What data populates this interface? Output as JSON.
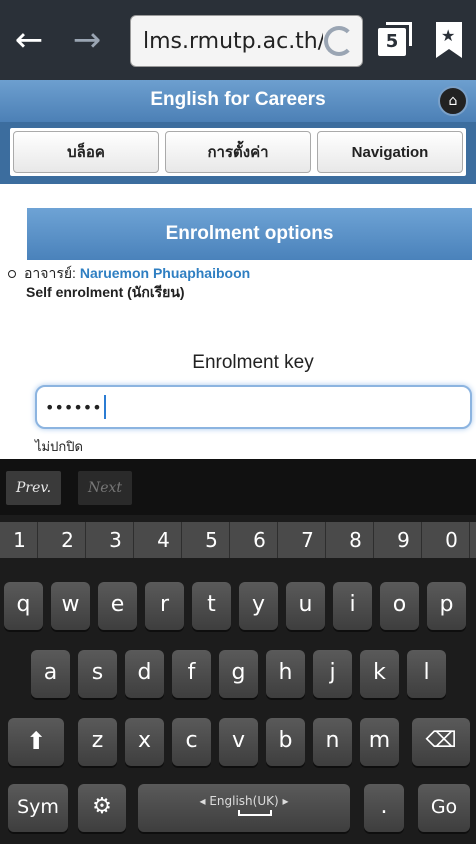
{
  "browser": {
    "url": "lms.rmutp.ac.th/l",
    "tab_count": "5",
    "back_icon": "arrow-left-icon",
    "forward_icon": "arrow-right-icon"
  },
  "app": {
    "title": "English for Careers",
    "tabs": [
      {
        "label": "บล็อค"
      },
      {
        "label": "การตั้งค่า"
      },
      {
        "label": "Navigation"
      }
    ]
  },
  "content": {
    "section_title": "Enrolment options",
    "teacher_prefix": "อาจารย์:",
    "teacher_name": "Naruemon Phuaphaiboon",
    "self_enrol": "Self enrolment (นักเรียน)",
    "key_label": "Enrolment key",
    "key_value": "••••••",
    "unmask_label": "ไม่ปกปิด"
  },
  "keyboard": {
    "prev": "Prev.",
    "next": "Next",
    "numbers": [
      "1",
      "2",
      "3",
      "4",
      "5",
      "6",
      "7",
      "8",
      "9",
      "0"
    ],
    "row1": [
      "q",
      "w",
      "e",
      "r",
      "t",
      "y",
      "u",
      "i",
      "o",
      "p"
    ],
    "row2": [
      "a",
      "s",
      "d",
      "f",
      "g",
      "h",
      "j",
      "k",
      "l"
    ],
    "row3": [
      "z",
      "x",
      "c",
      "v",
      "b",
      "n",
      "m"
    ],
    "sym": "Sym",
    "space_label": "English(UK)",
    "period": ".",
    "go": "Go",
    "colors": {
      "background": "#1c1c1c",
      "key": "#4a4a4a"
    }
  }
}
